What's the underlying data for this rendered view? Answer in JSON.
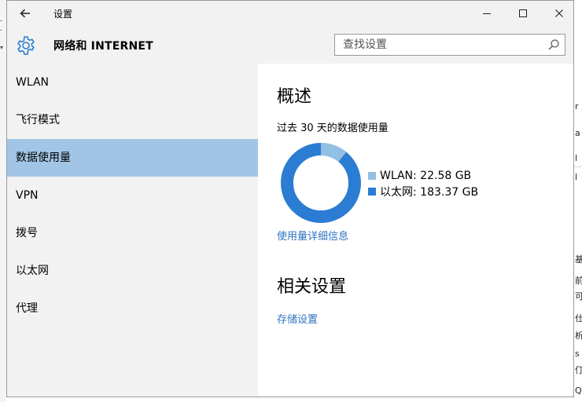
{
  "window": {
    "title": "设置",
    "header_title": "网络和 INTERNET"
  },
  "search": {
    "placeholder": "查找设置",
    "value": ""
  },
  "sidebar": {
    "items": [
      {
        "label": "WLAN",
        "active": false
      },
      {
        "label": "飞行模式",
        "active": false
      },
      {
        "label": "数据使用量",
        "active": true
      },
      {
        "label": "VPN",
        "active": false
      },
      {
        "label": "拨号",
        "active": false
      },
      {
        "label": "以太网",
        "active": false
      },
      {
        "label": "代理",
        "active": false
      }
    ]
  },
  "content": {
    "overview_heading": "概述",
    "period_label": "过去 30 天的数据使用量",
    "usage": [
      {
        "label": "WLAN: 22.58 GB",
        "gb": 22.58,
        "color": "#93bfe5"
      },
      {
        "label": "以太网: 183.37 GB",
        "gb": 183.37,
        "color": "#2b7cd3"
      }
    ],
    "details_link": "使用量详细信息",
    "related_heading": "相关设置",
    "storage_link": "存储设置"
  },
  "colors": {
    "accent": "#2d73c0",
    "active_item": "#a2c5e6",
    "sidebar_bg": "#f2f2f2"
  },
  "icons": {
    "back": "back-arrow-icon",
    "settings": "gear-icon",
    "search": "search-icon",
    "minimize": "minimize-icon",
    "maximize": "maximize-icon",
    "close": "close-icon"
  }
}
